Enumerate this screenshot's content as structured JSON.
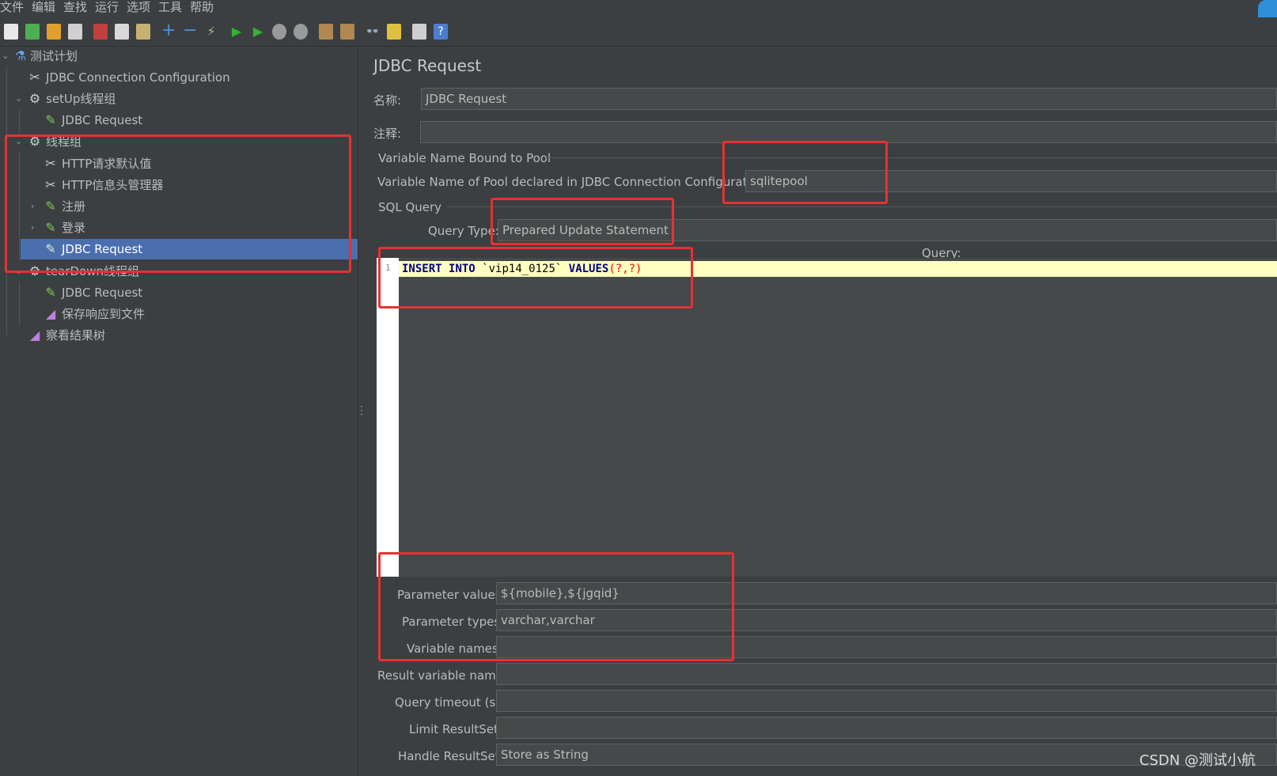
{
  "menu": [
    "文件",
    "编辑",
    "查找",
    "运行",
    "选项",
    "工具",
    "帮助"
  ],
  "toolbar_icons": [
    "new-icon",
    "templates-icon",
    "open-icon",
    "save-icon",
    "cut-icon",
    "copy-icon",
    "paste-icon",
    "expand-icon",
    "collapse-icon",
    "toggle-icon",
    "start-icon",
    "start-no-pause-icon",
    "stop-icon",
    "shutdown-icon",
    "clear-icon",
    "clear-all-icon",
    "search-icon",
    "reset-search-icon",
    "function-helper-icon",
    "help-icon"
  ],
  "tree": {
    "items": [
      {
        "label": "测试计划",
        "icon": "flask-icon"
      },
      {
        "label": "JDBC Connection Configuration",
        "icon": "wrench-icon"
      },
      {
        "label": "setUp线程组",
        "icon": "gear-icon"
      },
      {
        "label": "JDBC Request",
        "icon": "pipette-icon"
      },
      {
        "label": "线程组",
        "icon": "gear-icon"
      },
      {
        "label": "HTTP请求默认值",
        "icon": "wrench-icon"
      },
      {
        "label": "HTTP信息头管理器",
        "icon": "wrench-icon"
      },
      {
        "label": "注册",
        "icon": "pipette-icon"
      },
      {
        "label": "登录",
        "icon": "pipette-icon"
      },
      {
        "label": "JDBC Request",
        "icon": "pipette-icon"
      },
      {
        "label": "tearDown线程组",
        "icon": "gear-icon"
      },
      {
        "label": "JDBC Request",
        "icon": "pipette-icon"
      },
      {
        "label": "保存响应到文件",
        "icon": "chart-icon"
      },
      {
        "label": "察看结果树",
        "icon": "chart-icon"
      }
    ]
  },
  "panel": {
    "title": "JDBC Request",
    "name_label": "名称:",
    "name_value": "JDBC Request",
    "comment_label": "注释:",
    "comment_value": "",
    "pool_section": "Variable Name Bound to Pool",
    "pool_label": "Variable Name of Pool declared in JDBC Connection Configuration:",
    "pool_value": "sqlitepool",
    "sql_section": "SQL Query",
    "query_type_label": "Query Type:",
    "query_type_value": "Prepared Update Statement",
    "query_label": "Query:",
    "line_number": "1",
    "code": {
      "kw1": "INSERT",
      "kw2": "INTO",
      "table": "`vip14_0125`",
      "kw3": "VALUES",
      "args": "(?,?)"
    },
    "param_values_label": "Parameter values:",
    "param_values_value": "${mobile},${jgqid}",
    "param_types_label": "Parameter types:",
    "param_types_value": "varchar,varchar",
    "variable_names_label": "Variable names:",
    "variable_names_value": "",
    "result_var_label": "Result variable name:",
    "result_var_value": "",
    "timeout_label": "Query timeout (s):",
    "timeout_value": "",
    "limit_label": "Limit ResultSet:",
    "limit_value": "",
    "handle_label": "Handle ResultSet:",
    "handle_value": "Store as String"
  },
  "watermark": "CSDN @测试小航",
  "colors": {
    "background": "#3c3f41",
    "selection": "#4b6eaf",
    "highlight_box": "#e53232",
    "code_keyword": "#000080",
    "code_paren": "#ff0000",
    "code_line_bg": "#ffffc0"
  }
}
